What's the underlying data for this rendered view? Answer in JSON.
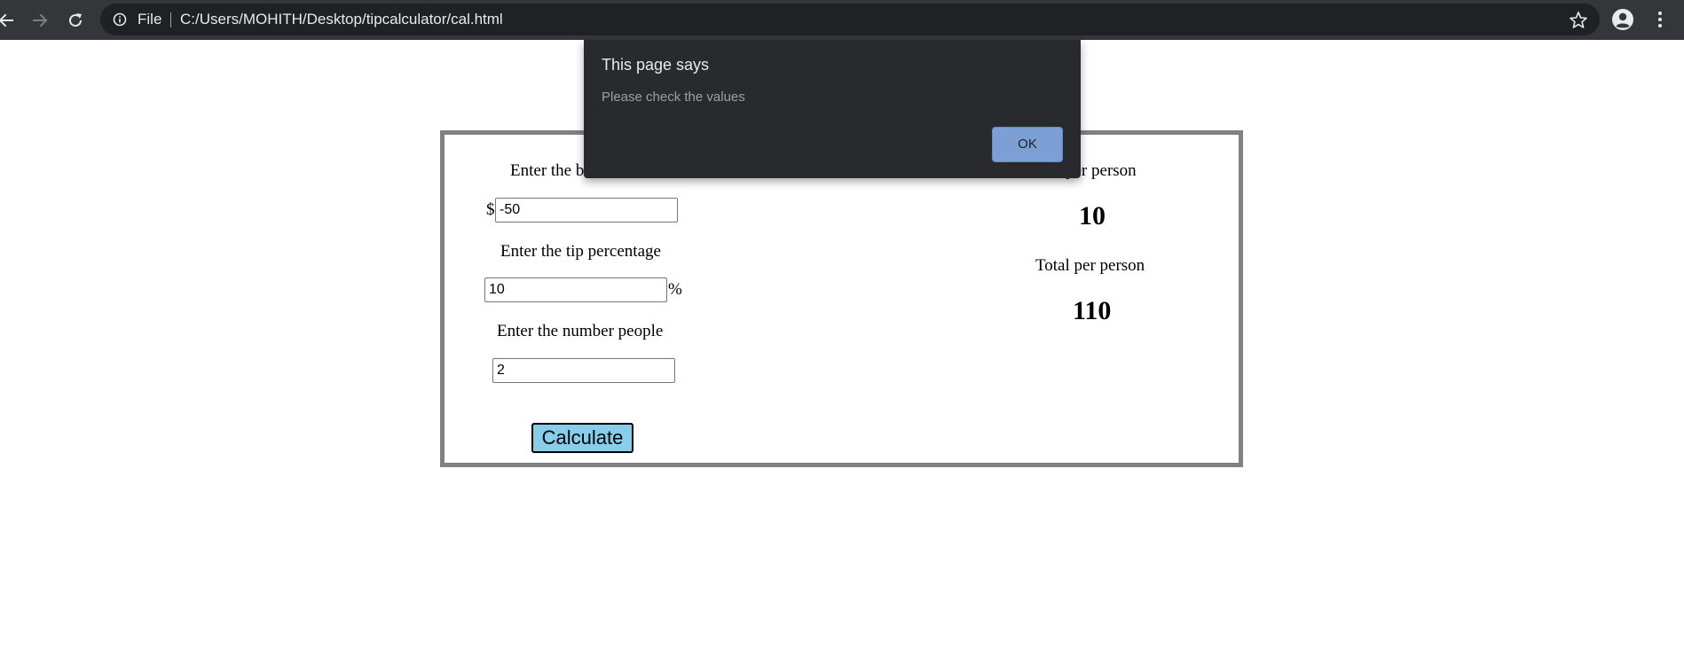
{
  "browser": {
    "scheme_label": "File",
    "url": "C:/Users/MOHITH/Desktop/tipcalculator/cal.html"
  },
  "form": {
    "bill_label": "Enter the b",
    "currency_symbol": "$",
    "bill_value": "-50",
    "tip_label": "Enter the tip percentage",
    "tip_value": "10",
    "percent_symbol": "%",
    "people_label": "Enter the number people",
    "people_value": "2",
    "calculate_label": "Calculate"
  },
  "results": {
    "tip_label": "per person",
    "tip_value": "10",
    "total_label": "Total per person",
    "total_value": "110"
  },
  "dialog": {
    "title": "This page says",
    "message": "Please check the values",
    "ok_label": "OK"
  },
  "colors": {
    "toolbar_bg": "#35363a",
    "omnibox_bg": "#202124",
    "dialog_bg": "#292a2d",
    "ok_button_bg": "#7c9fd6",
    "calculate_button_bg": "#87ceeb",
    "box_border": "#808080"
  },
  "icons": {
    "back": "arrow-left-icon",
    "forward": "arrow-right-icon",
    "reload": "reload-icon",
    "site_info": "info-icon",
    "bookmark": "star-icon",
    "profile": "account-circle-icon",
    "menu": "more-vertical-icon"
  }
}
